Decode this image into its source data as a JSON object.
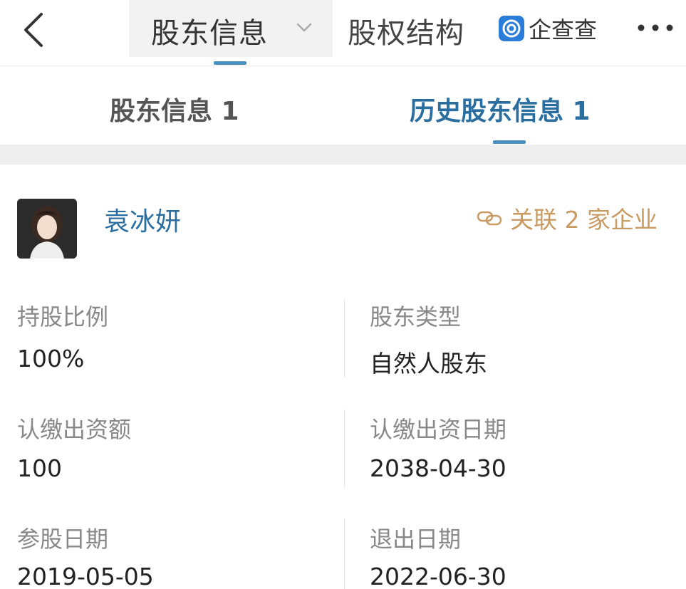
{
  "header": {
    "tab_primary": "股东信息",
    "tab_secondary": "股权结构",
    "brand": "企查查"
  },
  "subtabs": {
    "current": "股东信息 1",
    "history": "历史股东信息 1"
  },
  "shareholder": {
    "name": "袁冰妍",
    "related": "关联 2 家企业"
  },
  "fields": {
    "ratio_label": "持股比例",
    "ratio_value": "100%",
    "type_label": "股东类型",
    "type_value": "自然人股东",
    "amount_label": "认缴出资额",
    "amount_value": "100",
    "date_label": "认缴出资日期",
    "date_value": "2038-04-30",
    "join_label": "参股日期",
    "join_value": "2019-05-05",
    "exit_label": "退出日期",
    "exit_value": "2022-06-30"
  },
  "colors": {
    "accent": "#2a6ea0",
    "related": "#c99a62",
    "underline": "#4a90c0"
  },
  "icons": {
    "back": "back-arrow-icon",
    "dropdown": "chevron-down-icon",
    "brand_logo": "qichacha-logo-icon",
    "more": "more-dots-icon",
    "related": "link-icon"
  }
}
